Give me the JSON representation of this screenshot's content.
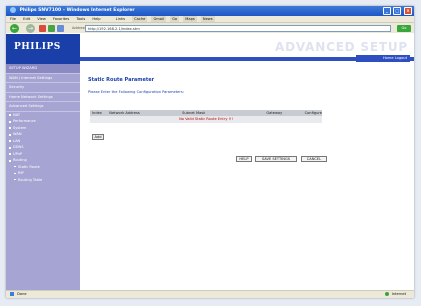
{
  "window": {
    "title": "Philips SNV7100 – Windows Internet Explorer",
    "controls": {
      "minimize": "_",
      "maximize": "□",
      "close": "×"
    }
  },
  "menubar": {
    "items": [
      "File",
      "Edit",
      "View",
      "Favorites",
      "Tools",
      "Help"
    ],
    "links_label": "Links",
    "links": [
      "Cache",
      "Gmail",
      "Go",
      "Maps",
      "News"
    ]
  },
  "toolbar": {
    "back_label": "Back",
    "address_label": "Address",
    "address_value": "http://192.168.2.1/index.stm",
    "go_label": "Go"
  },
  "header": {
    "brand": "PHILIPS",
    "title": "ADVANCED SETUP",
    "buttons_label": "Home  Logout"
  },
  "sidebar": {
    "items": [
      {
        "label": "SETUP WIZARD",
        "highlight": true
      },
      {
        "label": "WAN / Internet Settings"
      },
      {
        "label": "Security"
      },
      {
        "label": "Home Network Settings"
      },
      {
        "label": "Advanced Settings"
      }
    ],
    "sub_items": [
      "NAT",
      "Performance",
      "System",
      "WAN",
      "LAN",
      "DDNS",
      "UPnP",
      "Routing"
    ],
    "routing_children": [
      "Static Route",
      "RIP",
      "Routing Table"
    ]
  },
  "main": {
    "page_title": "Static Route Parameter",
    "instruction": "Please Enter the Following Configuration Parameters:",
    "table_columns": [
      "Index",
      "Network Address",
      "Subnet Mask",
      "Gateway",
      "Configure"
    ],
    "empty_message": "No Valid Static Route Entry !!!",
    "add_button": "Add",
    "help_button": "HELP",
    "save_button": "SAVE SETTINGS",
    "cancel_button": "CANCEL"
  },
  "statusbar": {
    "left_text": "Done",
    "right_text": "Internet"
  },
  "colors": {
    "brand_blue": "#1b3fa8",
    "sidebar_purple": "#a6a4d2",
    "error_red": "#c00000"
  }
}
